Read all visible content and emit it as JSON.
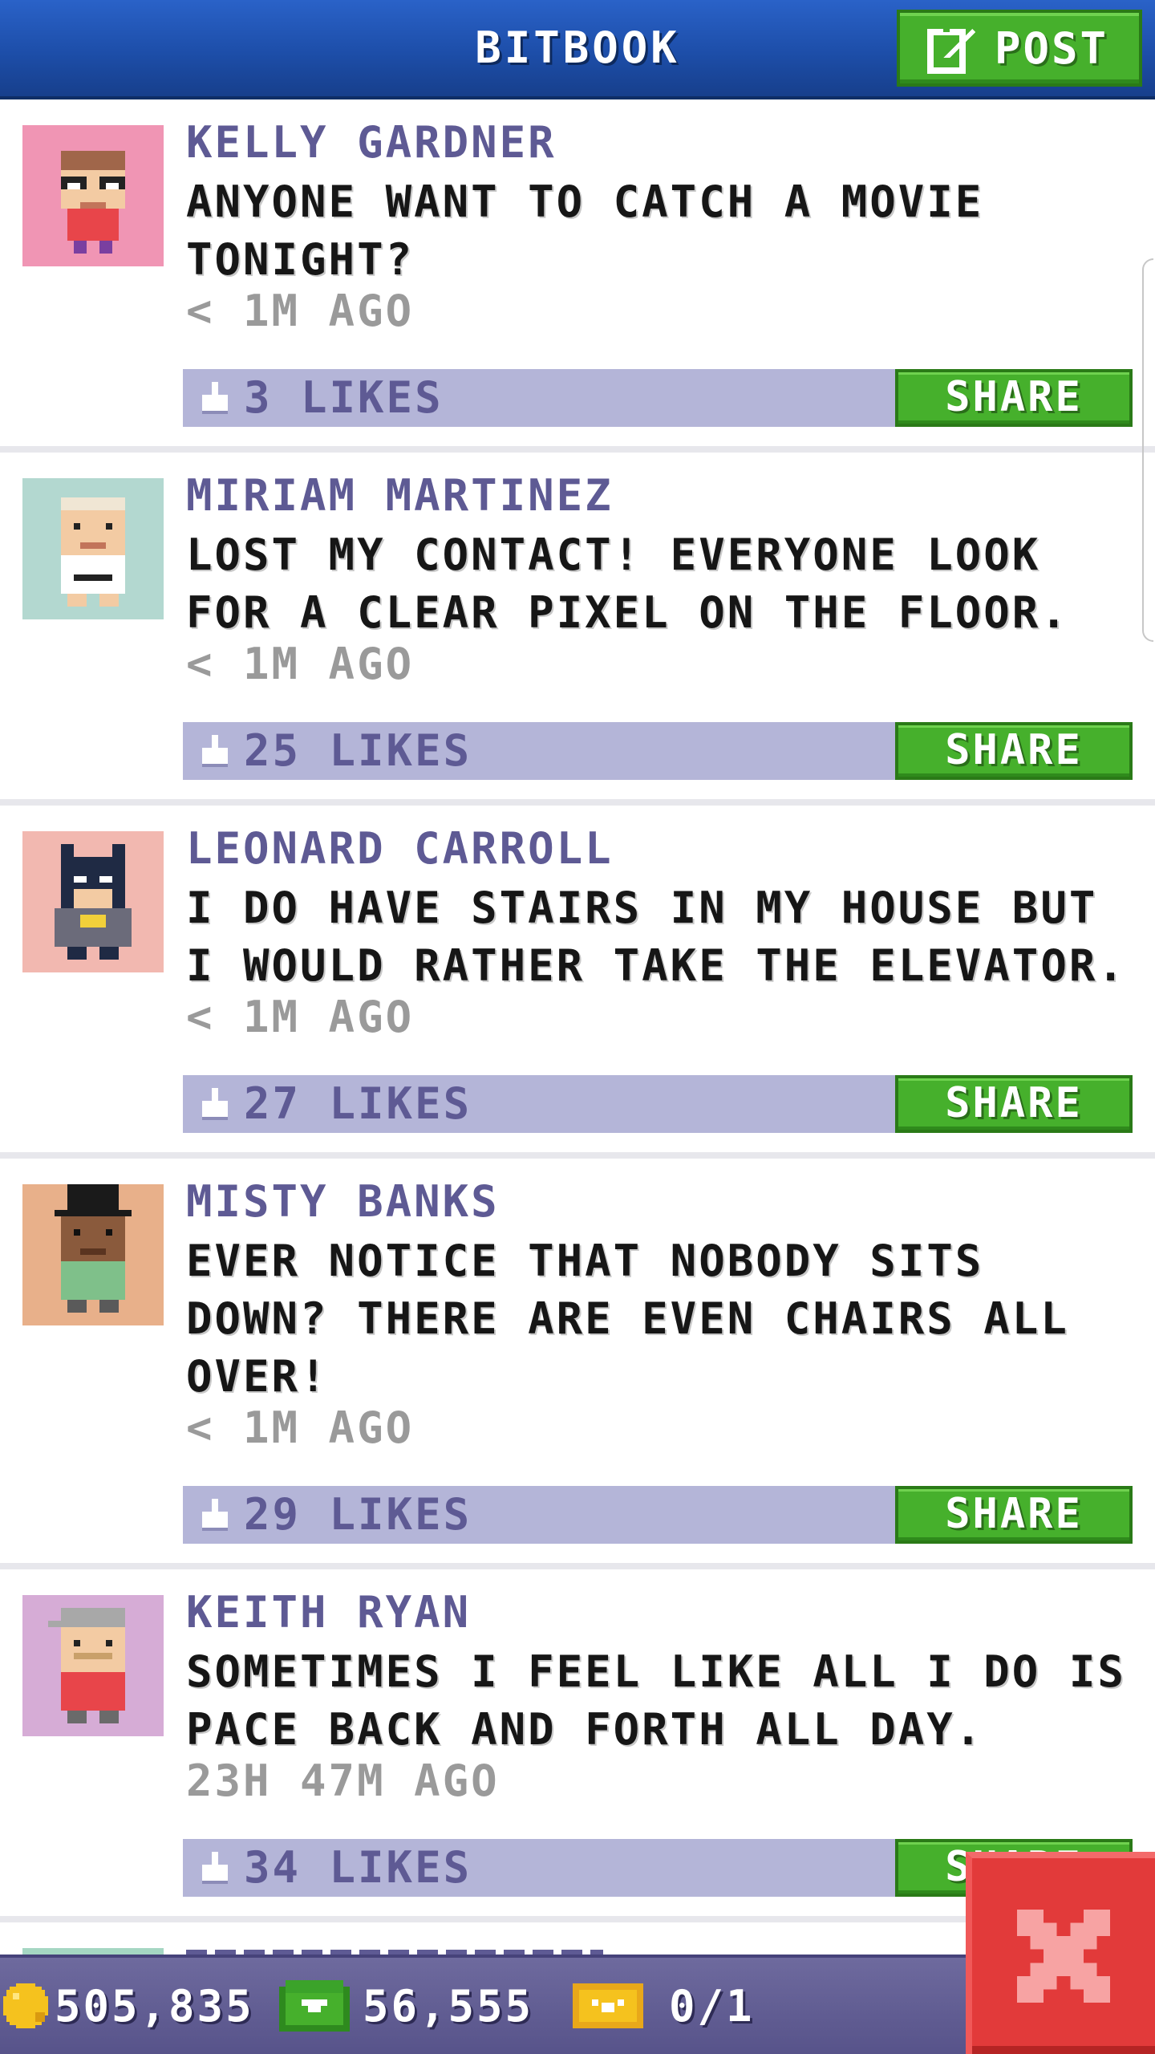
{
  "header": {
    "title": "BITBOOK",
    "post_label": "POST"
  },
  "posts": [
    {
      "name": "KELLY GARDNER",
      "text": "ANYONE WANT TO CATCH A MOVIE TONIGHT?",
      "time": "< 1M AGO",
      "likes": "3 LIKES",
      "share": "SHARE"
    },
    {
      "name": "MIRIAM MARTINEZ",
      "text": "LOST MY CONTACT! EVERYONE LOOK FOR A CLEAR PIXEL ON THE FLOOR.",
      "time": "< 1M AGO",
      "likes": "25 LIKES",
      "share": "SHARE"
    },
    {
      "name": "LEONARD CARROLL",
      "text": "I DO HAVE STAIRS IN MY HOUSE BUT I WOULD RATHER TAKE THE ELEVATOR.",
      "time": "< 1M AGO",
      "likes": "27 LIKES",
      "share": "SHARE"
    },
    {
      "name": "MISTY BANKS",
      "text": "EVER NOTICE THAT NOBODY SITS DOWN? THERE ARE EVEN CHAIRS ALL OVER!",
      "time": "< 1M AGO",
      "likes": "29 LIKES",
      "share": "SHARE"
    },
    {
      "name": "KEITH RYAN",
      "text": "SOMETIMES I FEEL LIKE ALL I DO IS PACE BACK AND FORTH ALL DAY.",
      "time": "23H 47M AGO",
      "likes": "34 LIKES",
      "share": "SHARE"
    }
  ],
  "status": {
    "coins": "505,835",
    "bux": "56,555",
    "tickets": "0/1"
  },
  "colors": {
    "header": "#1d4ea9",
    "button_green": "#46b02c",
    "like_bar": "#b4b5d8",
    "name_purple": "#5e5a94",
    "close_red": "#e23a3a"
  },
  "icons": {
    "post": "edit-icon",
    "like": "thumb-up-icon",
    "coin": "coin-icon",
    "bux": "bux-icon",
    "ticket": "ticket-icon",
    "close": "close-icon"
  }
}
